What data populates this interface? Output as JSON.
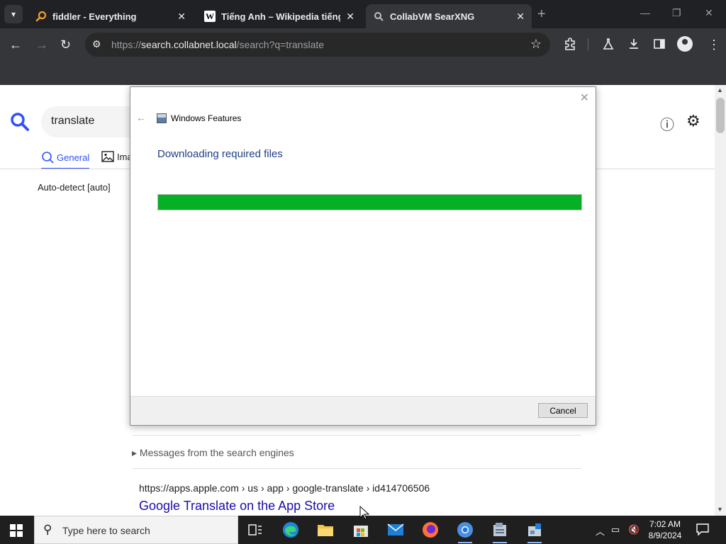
{
  "browser": {
    "tabs": [
      {
        "title": "fiddler - Everything",
        "active": false
      },
      {
        "title": "Tiếng Anh – Wikipedia tiếng V",
        "active": false
      },
      {
        "title": "CollabVM SearXNG",
        "active": true
      }
    ],
    "url_scheme": "https://",
    "url_host": "search.collabnet.local",
    "url_path": "/search?q=translate"
  },
  "page": {
    "search_query": "translate",
    "tabs": {
      "general": "General",
      "images": "Ima"
    },
    "language": "Auto-detect [auto]",
    "messages_toggle": "Messages from the search engines",
    "result": {
      "url": "https://apps.apple.com  › us › app › google-translate › id414706506",
      "title": "Google Translate on the App Store"
    }
  },
  "dialog": {
    "app_title": "Windows Features",
    "heading": "Downloading required files",
    "progress_fraction": 1.0,
    "cancel_label": "Cancel"
  },
  "taskbar": {
    "search_placeholder": "Type here to search",
    "time": "7:02 AM",
    "date": "8/9/2024"
  },
  "colors": {
    "progress_fill": "#06b025",
    "searxng_accent": "#3050ff",
    "link": "#1a0dab",
    "dialog_heading": "#1f3f87"
  },
  "icons": {
    "tab_fav_1": "search-orange-icon",
    "tab_fav_2": "wikipedia-icon",
    "tab_fav_3": "searxng-icon"
  }
}
